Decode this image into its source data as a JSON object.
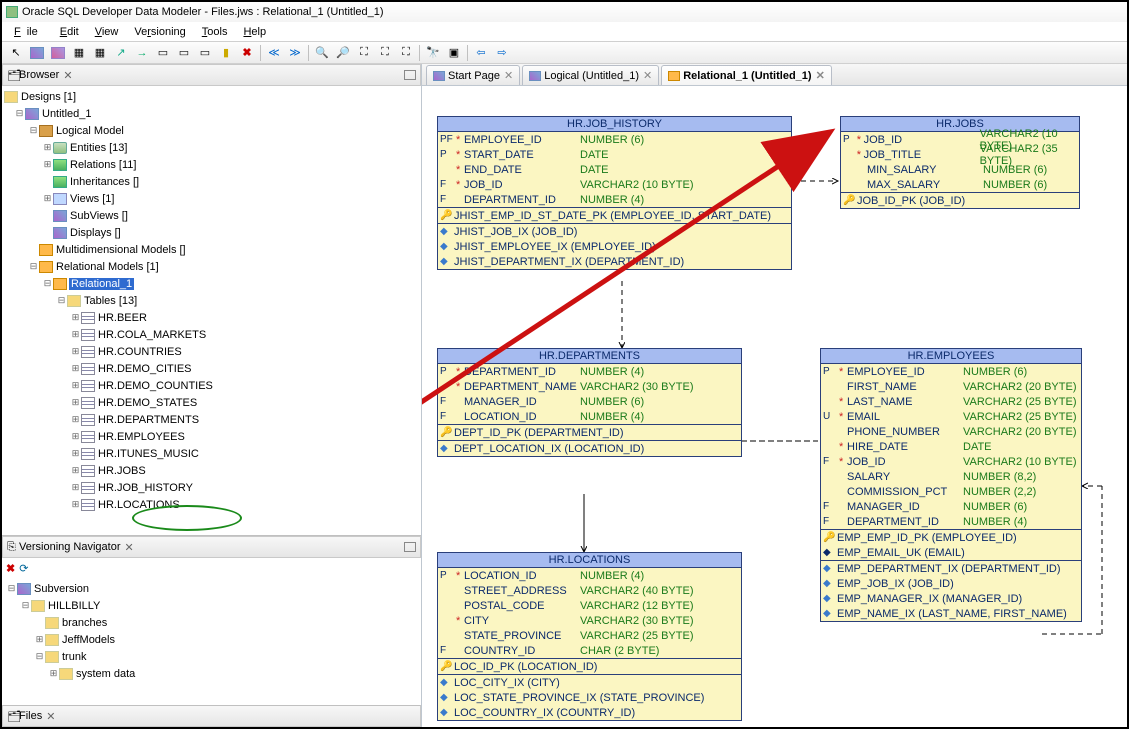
{
  "window_title": "Oracle SQL Developer Data Modeler - Files.jws : Relational_1 (Untitled_1)",
  "menu": {
    "file": "File",
    "edit": "Edit",
    "view": "View",
    "versioning": "Versioning",
    "tools": "Tools",
    "help": "Help"
  },
  "browser": {
    "title": "Browser",
    "root": "Designs [1]",
    "untitled": "Untitled_1",
    "logical": "Logical Model",
    "entities": "Entities [13]",
    "relations": "Relations [11]",
    "inheritances": "Inheritances []",
    "views": "Views [1]",
    "subviews": "SubViews []",
    "displays": "Displays []",
    "multi": "Multidimensional Models []",
    "relm": "Relational Models [1]",
    "rel1": "Relational_1",
    "tables": "Tables [13]",
    "tbls": [
      "HR.BEER",
      "HR.COLA_MARKETS",
      "HR.COUNTRIES",
      "HR.DEMO_CITIES",
      "HR.DEMO_COUNTIES",
      "HR.DEMO_STATES",
      "HR.DEPARTMENTS",
      "HR.EMPLOYEES",
      "HR.ITUNES_MUSIC",
      "HR.JOBS",
      "HR.JOB_HISTORY",
      "HR.LOCATIONS"
    ]
  },
  "versioning": {
    "title": "Versioning Navigator",
    "subv": "Subversion",
    "hill": "HILLBILLY",
    "branches": "branches",
    "jeff": "JeffModels",
    "trunk": "trunk",
    "sys": "system data"
  },
  "files_tab": "Files",
  "tabs": {
    "start": "Start Page",
    "logical": "Logical (Untitled_1)",
    "relational": "Relational_1 (Untitled_1)"
  },
  "erd": {
    "job_history": {
      "title": "HR.JOB_HISTORY",
      "cols": [
        {
          "mk": "PF",
          "st": "*",
          "name": "EMPLOYEE_ID",
          "type": "NUMBER (6)"
        },
        {
          "mk": "P",
          "st": "*",
          "name": "START_DATE",
          "type": "DATE"
        },
        {
          "mk": "",
          "st": "*",
          "name": "END_DATE",
          "type": "DATE"
        },
        {
          "mk": "F",
          "st": "*",
          "name": "JOB_ID",
          "type": "VARCHAR2 (10 BYTE)"
        },
        {
          "mk": "F",
          "st": "",
          "name": "DEPARTMENT_ID",
          "type": "NUMBER (4)"
        }
      ],
      "pk": "JHIST_EMP_ID_ST_DATE_PK (EMPLOYEE_ID, START_DATE)",
      "idx": [
        "JHIST_JOB_IX (JOB_ID)",
        "JHIST_EMPLOYEE_IX (EMPLOYEE_ID)",
        "JHIST_DEPARTMENT_IX (DEPARTMENT_ID)"
      ]
    },
    "jobs": {
      "title": "HR.JOBS",
      "cols": [
        {
          "mk": "P",
          "st": "*",
          "name": "JOB_ID",
          "type": "VARCHAR2 (10 BYTE)"
        },
        {
          "mk": "",
          "st": "*",
          "name": "JOB_TITLE",
          "type": "VARCHAR2 (35 BYTE)"
        },
        {
          "mk": "",
          "st": "",
          "name": "MIN_SALARY",
          "type": "NUMBER (6)"
        },
        {
          "mk": "",
          "st": "",
          "name": "MAX_SALARY",
          "type": "NUMBER (6)"
        }
      ],
      "pk": "JOB_ID_PK (JOB_ID)"
    },
    "departments": {
      "title": "HR.DEPARTMENTS",
      "cols": [
        {
          "mk": "P",
          "st": "*",
          "name": "DEPARTMENT_ID",
          "type": "NUMBER (4)"
        },
        {
          "mk": "",
          "st": "*",
          "name": "DEPARTMENT_NAME",
          "type": "VARCHAR2 (30 BYTE)"
        },
        {
          "mk": "F",
          "st": "",
          "name": "MANAGER_ID",
          "type": "NUMBER (6)"
        },
        {
          "mk": "F",
          "st": "",
          "name": "LOCATION_ID",
          "type": "NUMBER (4)"
        }
      ],
      "pk": "DEPT_ID_PK (DEPARTMENT_ID)",
      "idx": [
        "DEPT_LOCATION_IX (LOCATION_ID)"
      ]
    },
    "employees": {
      "title": "HR.EMPLOYEES",
      "cols": [
        {
          "mk": "P",
          "st": "*",
          "name": "EMPLOYEE_ID",
          "type": "NUMBER (6)"
        },
        {
          "mk": "",
          "st": "",
          "name": "FIRST_NAME",
          "type": "VARCHAR2 (20 BYTE)"
        },
        {
          "mk": "",
          "st": "*",
          "name": "LAST_NAME",
          "type": "VARCHAR2 (25 BYTE)"
        },
        {
          "mk": "U",
          "st": "*",
          "name": "EMAIL",
          "type": "VARCHAR2 (25 BYTE)"
        },
        {
          "mk": "",
          "st": "",
          "name": "PHONE_NUMBER",
          "type": "VARCHAR2 (20 BYTE)"
        },
        {
          "mk": "",
          "st": "*",
          "name": "HIRE_DATE",
          "type": "DATE"
        },
        {
          "mk": "F",
          "st": "*",
          "name": "JOB_ID",
          "type": "VARCHAR2 (10 BYTE)"
        },
        {
          "mk": "",
          "st": "",
          "name": "SALARY",
          "type": "NUMBER (8,2)"
        },
        {
          "mk": "",
          "st": "",
          "name": "COMMISSION_PCT",
          "type": "NUMBER (2,2)"
        },
        {
          "mk": "F",
          "st": "",
          "name": "MANAGER_ID",
          "type": "NUMBER (6)"
        },
        {
          "mk": "F",
          "st": "",
          "name": "DEPARTMENT_ID",
          "type": "NUMBER (4)"
        }
      ],
      "pk": "EMP_EMP_ID_PK (EMPLOYEE_ID)",
      "uk": "EMP_EMAIL_UK (EMAIL)",
      "idx": [
        "EMP_DEPARTMENT_IX (DEPARTMENT_ID)",
        "EMP_JOB_IX (JOB_ID)",
        "EMP_MANAGER_IX (MANAGER_ID)",
        "EMP_NAME_IX (LAST_NAME, FIRST_NAME)"
      ]
    },
    "locations": {
      "title": "HR.LOCATIONS",
      "cols": [
        {
          "mk": "P",
          "st": "*",
          "name": "LOCATION_ID",
          "type": "NUMBER (4)"
        },
        {
          "mk": "",
          "st": "",
          "name": "STREET_ADDRESS",
          "type": "VARCHAR2 (40 BYTE)"
        },
        {
          "mk": "",
          "st": "",
          "name": "POSTAL_CODE",
          "type": "VARCHAR2 (12 BYTE)"
        },
        {
          "mk": "",
          "st": "*",
          "name": "CITY",
          "type": "VARCHAR2 (30 BYTE)"
        },
        {
          "mk": "",
          "st": "",
          "name": "STATE_PROVINCE",
          "type": "VARCHAR2 (25 BYTE)"
        },
        {
          "mk": "F",
          "st": "",
          "name": "COUNTRY_ID",
          "type": "CHAR (2 BYTE)"
        }
      ],
      "pk": "LOC_ID_PK (LOCATION_ID)",
      "idx": [
        "LOC_CITY_IX (CITY)",
        "LOC_STATE_PROVINCE_IX (STATE_PROVINCE)",
        "LOC_COUNTRY_IX (COUNTRY_ID)"
      ]
    }
  }
}
